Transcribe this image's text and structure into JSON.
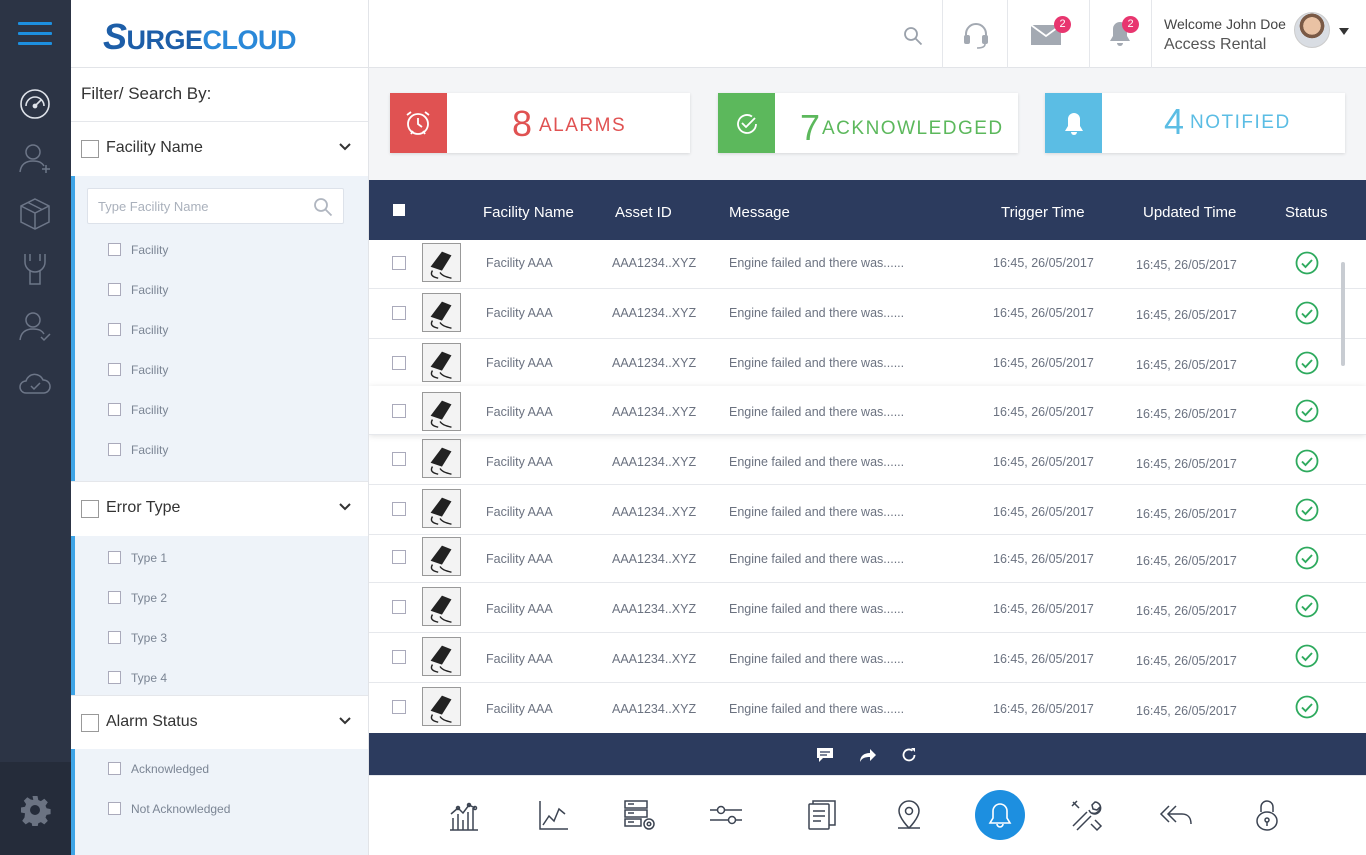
{
  "brand": {
    "logo_s": "S",
    "logo_a": "URGE",
    "logo_b": "CLOUD"
  },
  "header": {
    "mail_badge": "2",
    "bell_badge": "2",
    "welcome": "Welcome John Doe",
    "company": "Access Rental"
  },
  "filter": {
    "title": "Filter/ Search By:",
    "facility": {
      "label": "Facility Name",
      "placeholder": "Type Facility Name",
      "options": [
        "Facility",
        "Facility",
        "Facility",
        "Facility",
        "Facility",
        "Facility"
      ]
    },
    "error": {
      "label": "Error Type",
      "options": [
        "Type 1",
        "Type 2",
        "Type 3",
        "Type 4"
      ]
    },
    "alarm": {
      "label": "Alarm Status",
      "options": [
        "Acknowledged",
        "Not Acknowledged"
      ]
    }
  },
  "stats": {
    "alarms": {
      "num": "8",
      "label": "ALARMS",
      "color": "#e05252"
    },
    "ack": {
      "num": "7",
      "label": "ACKNOWLEDGED",
      "color": "#5cb85c"
    },
    "notified": {
      "num": "4",
      "label": "NOTIFIED",
      "color": "#5bbde4"
    }
  },
  "table": {
    "headers": {
      "facility": "Facility Name",
      "asset": "Asset ID",
      "message": "Message",
      "trigger": "Trigger Time",
      "updated": "Updated Time",
      "status": "Status"
    },
    "rows": [
      {
        "facility": "Facility AAA",
        "asset": "AAA1234..XYZ",
        "message": "Engine failed and there was......",
        "trigger": "16:45, 26/05/2017",
        "updated": "16:45, 26/05/2017"
      },
      {
        "facility": "Facility AAA",
        "asset": "AAA1234..XYZ",
        "message": "Engine failed and there was......",
        "trigger": "16:45, 26/05/2017",
        "updated": "16:45, 26/05/2017"
      },
      {
        "facility": "Facility AAA",
        "asset": "AAA1234..XYZ",
        "message": "Engine failed and there was......",
        "trigger": "16:45, 26/05/2017",
        "updated": "16:45, 26/05/2017"
      },
      {
        "facility": "Facility AAA",
        "asset": "AAA1234..XYZ",
        "message": "Engine failed and there was......",
        "trigger": "16:45, 26/05/2017",
        "updated": "16:45, 26/05/2017"
      },
      {
        "facility": "Facility AAA",
        "asset": "AAA1234..XYZ",
        "message": "Engine failed and there was......",
        "trigger": "16:45, 26/05/2017",
        "updated": "16:45, 26/05/2017"
      },
      {
        "facility": "Facility AAA",
        "asset": "AAA1234..XYZ",
        "message": "Engine failed and there was......",
        "trigger": "16:45, 26/05/2017",
        "updated": "16:45, 26/05/2017"
      },
      {
        "facility": "Facility AAA",
        "asset": "AAA1234..XYZ",
        "message": "Engine failed and there was......",
        "trigger": "16:45, 26/05/2017",
        "updated": "16:45, 26/05/2017"
      },
      {
        "facility": "Facility AAA",
        "asset": "AAA1234..XYZ",
        "message": "Engine failed and there was......",
        "trigger": "16:45, 26/05/2017",
        "updated": "16:45, 26/05/2017"
      },
      {
        "facility": "Facility AAA",
        "asset": "AAA1234..XYZ",
        "message": "Engine failed and there was......",
        "trigger": "16:45, 26/05/2017",
        "updated": "16:45, 26/05/2017"
      },
      {
        "facility": "Facility AAA",
        "asset": "AAA1234..XYZ",
        "message": "Engine failed and there was......",
        "trigger": "16:45, 26/05/2017",
        "updated": "16:45, 26/05/2017"
      }
    ]
  },
  "colors": {
    "accent": "#1d8fe0",
    "navy": "#2c3b5e",
    "ok": "#2eaa5e"
  },
  "icons": {
    "rail": [
      "dashboard-icon",
      "add-user-icon",
      "box-icon",
      "wrench-icon",
      "user-check-icon",
      "cloud-check-icon",
      "settings-icon"
    ],
    "dock": [
      "analytics-icon",
      "line-chart-icon",
      "server-settings-icon",
      "sliders-icon",
      "report-icon",
      "location-icon",
      "bell-icon",
      "tools-icon",
      "reply-all-icon",
      "lock-icon"
    ]
  }
}
